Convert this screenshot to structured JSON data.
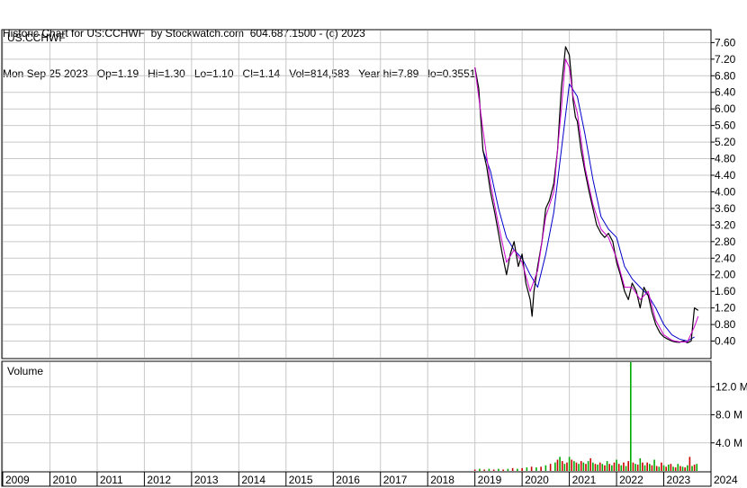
{
  "header": {
    "line1": "Historic Chart for US:CCHWF  by Stockwatch.com  604.687.1500 - (c) 2023",
    "line2": "Mon Sep 25 2023   Op=1.19   Hi=1.30   Lo=1.10   Cl=1.14   Vol=814,583   Year hi=7.89   lo=0.3551"
  },
  "chart_data": [
    {
      "type": "line",
      "panel": "price",
      "label": "US:CCHWF",
      "y_ticks": [
        "0.40",
        "0.80",
        "1.20",
        "1.60",
        "2.00",
        "2.40",
        "2.80",
        "3.20",
        "3.60",
        "4.00",
        "4.40",
        "4.80",
        "5.20",
        "5.60",
        "6.00",
        "6.40",
        "6.80",
        "7.20",
        "7.60"
      ],
      "ylim": [
        0.0,
        7.89
      ],
      "x_years": [
        "2009",
        "2010",
        "2011",
        "2012",
        "2013",
        "2014",
        "2015",
        "2016",
        "2017",
        "2018",
        "2019",
        "2020",
        "2021",
        "2022",
        "2023",
        "2024"
      ],
      "x_start_year": 2009.0,
      "x_end_year": 2024.0,
      "series": [
        {
          "role": "price",
          "color": "#000000",
          "x": [
            2019.0,
            2019.08,
            2019.17,
            2019.25,
            2019.33,
            2019.42,
            2019.5,
            2019.58,
            2019.67,
            2019.75,
            2019.83,
            2019.92,
            2020.0,
            2020.08,
            2020.17,
            2020.21,
            2020.25,
            2020.33,
            2020.42,
            2020.5,
            2020.58,
            2020.67,
            2020.75,
            2020.83,
            2020.92,
            2021.0,
            2021.04,
            2021.08,
            2021.13,
            2021.17,
            2021.25,
            2021.33,
            2021.42,
            2021.5,
            2021.58,
            2021.67,
            2021.75,
            2021.83,
            2021.92,
            2022.0,
            2022.08,
            2022.17,
            2022.25,
            2022.33,
            2022.42,
            2022.5,
            2022.58,
            2022.67,
            2022.75,
            2022.83,
            2022.92,
            2023.0,
            2023.08,
            2023.17,
            2023.25,
            2023.33,
            2023.42,
            2023.5,
            2023.58,
            2023.65,
            2023.73
          ],
          "y": [
            7.0,
            6.5,
            5.0,
            4.6,
            4.0,
            3.5,
            3.0,
            2.5,
            2.0,
            2.5,
            2.8,
            2.2,
            2.5,
            1.8,
            1.4,
            1.0,
            1.6,
            2.2,
            2.8,
            3.6,
            3.8,
            4.2,
            5.0,
            6.5,
            7.5,
            7.3,
            6.8,
            6.2,
            5.8,
            5.7,
            5.0,
            4.5,
            4.0,
            3.6,
            3.2,
            3.0,
            2.9,
            3.0,
            2.8,
            2.3,
            2.0,
            1.6,
            1.4,
            1.8,
            1.6,
            1.2,
            1.7,
            1.5,
            1.1,
            0.8,
            0.6,
            0.5,
            0.45,
            0.4,
            0.38,
            0.37,
            0.4,
            0.36,
            0.4,
            1.2,
            1.14
          ]
        },
        {
          "role": "short-average",
          "color": "#cc00cc",
          "x": [
            2019.0,
            2019.17,
            2019.33,
            2019.5,
            2019.67,
            2019.83,
            2020.0,
            2020.17,
            2020.33,
            2020.5,
            2020.67,
            2020.83,
            2020.92,
            2021.0,
            2021.08,
            2021.17,
            2021.33,
            2021.5,
            2021.67,
            2021.83,
            2022.0,
            2022.17,
            2022.33,
            2022.5,
            2022.67,
            2022.83,
            2023.0,
            2023.17,
            2023.33,
            2023.5,
            2023.65,
            2023.73
          ],
          "y": [
            7.0,
            5.5,
            4.2,
            3.2,
            2.3,
            2.6,
            2.3,
            1.6,
            2.1,
            3.4,
            4.0,
            6.0,
            7.2,
            7.0,
            6.3,
            5.9,
            4.6,
            3.7,
            3.1,
            2.9,
            2.4,
            1.7,
            1.7,
            1.4,
            1.6,
            0.9,
            0.55,
            0.42,
            0.38,
            0.38,
            0.75,
            1.0
          ]
        },
        {
          "role": "long-average",
          "color": "#0000cc",
          "x": [
            2019.17,
            2019.33,
            2019.5,
            2019.67,
            2019.83,
            2020.0,
            2020.17,
            2020.33,
            2020.5,
            2020.67,
            2020.83,
            2021.0,
            2021.17,
            2021.33,
            2021.5,
            2021.67,
            2021.83,
            2022.0,
            2022.17,
            2022.33,
            2022.5,
            2022.67,
            2022.83,
            2023.0,
            2023.17,
            2023.33,
            2023.5,
            2023.65
          ],
          "y": [
            5.0,
            4.5,
            3.6,
            2.9,
            2.6,
            2.4,
            2.0,
            1.7,
            2.5,
            3.5,
            5.0,
            6.6,
            6.3,
            5.4,
            4.3,
            3.4,
            3.1,
            2.9,
            2.2,
            1.9,
            1.7,
            1.5,
            1.2,
            0.8,
            0.55,
            0.45,
            0.4,
            0.5
          ]
        }
      ]
    },
    {
      "type": "bar",
      "panel": "volume",
      "label": "Volume",
      "y_ticks": [
        "4.0 M",
        "8.0 M",
        "12.0 M"
      ],
      "y_tick_values": [
        4.0,
        8.0,
        12.0
      ],
      "ylim": [
        0,
        15.5
      ],
      "series": [
        {
          "role": "volume",
          "colors": [
            "#cc0000",
            "#00aa00"
          ],
          "x": [
            2019.0,
            2019.1,
            2019.2,
            2019.3,
            2019.4,
            2019.5,
            2019.6,
            2019.7,
            2019.8,
            2019.9,
            2020.0,
            2020.1,
            2020.2,
            2020.3,
            2020.4,
            2020.5,
            2020.6,
            2020.7,
            2020.75,
            2020.8,
            2020.85,
            2020.9,
            2020.95,
            2021.0,
            2021.05,
            2021.1,
            2021.15,
            2021.2,
            2021.25,
            2021.3,
            2021.35,
            2021.4,
            2021.45,
            2021.5,
            2021.55,
            2021.6,
            2021.65,
            2021.7,
            2021.75,
            2021.8,
            2021.85,
            2021.9,
            2021.95,
            2022.0,
            2022.05,
            2022.1,
            2022.15,
            2022.2,
            2022.25,
            2022.3,
            2022.35,
            2022.4,
            2022.45,
            2022.5,
            2022.55,
            2022.6,
            2022.65,
            2022.7,
            2022.75,
            2022.8,
            2022.85,
            2022.9,
            2022.95,
            2023.0,
            2023.05,
            2023.1,
            2023.15,
            2023.2,
            2023.25,
            2023.3,
            2023.35,
            2023.4,
            2023.45,
            2023.5,
            2023.55,
            2023.6,
            2023.65,
            2023.7
          ],
          "values": [
            0.2,
            0.3,
            0.2,
            0.3,
            0.2,
            0.3,
            0.2,
            0.3,
            0.4,
            0.3,
            0.4,
            0.5,
            0.6,
            0.5,
            0.6,
            0.8,
            1.0,
            1.2,
            1.6,
            2.0,
            1.4,
            1.0,
            1.2,
            2.0,
            1.6,
            1.4,
            1.2,
            1.0,
            1.4,
            1.2,
            1.0,
            1.4,
            1.8,
            1.2,
            1.0,
            0.9,
            1.2,
            1.0,
            0.8,
            1.4,
            1.0,
            0.8,
            1.2,
            1.6,
            1.0,
            0.8,
            1.2,
            0.7,
            1.4,
            15.5,
            1.2,
            1.0,
            0.9,
            1.8,
            1.2,
            0.8,
            1.2,
            1.0,
            0.8,
            1.6,
            0.7,
            0.6,
            1.2,
            0.8,
            0.6,
            0.9,
            1.0,
            0.6,
            0.5,
            1.0,
            0.7,
            0.6,
            0.5,
            0.8,
            2.0,
            0.7,
            0.9,
            1.0
          ]
        }
      ]
    }
  ]
}
